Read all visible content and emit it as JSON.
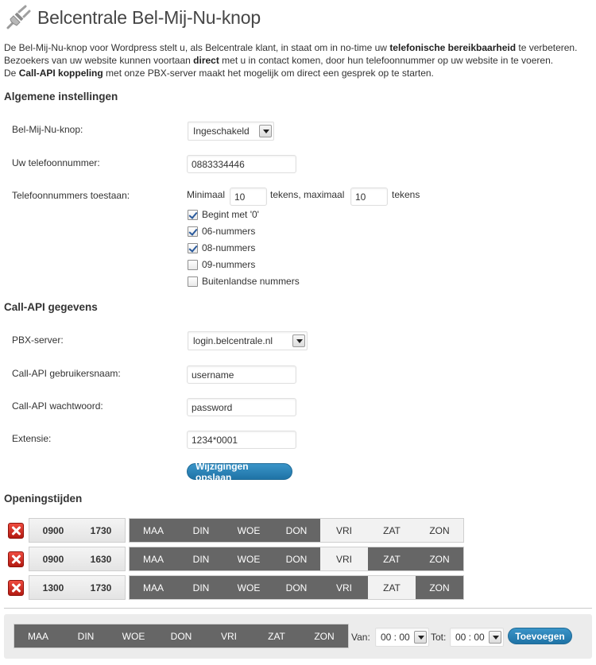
{
  "header": {
    "title": "Belcentrale Bel-Mij-Nu-knop"
  },
  "intro": {
    "line1_pre": "De Bel-Mij-Nu-knop voor Wordpress stelt u, als Belcentrale klant, in staat om in no-time uw ",
    "line1_bold": "telefonische bereikbaarheid",
    "line1_post": " te verbeteren.",
    "line2_pre": "Bezoekers van uw website kunnen voortaan ",
    "line2_bold": "direct",
    "line2_post": " met u in contact komen, door hun telefoonnummer op uw website in te voeren.",
    "line3_pre": "De ",
    "line3_bold": "Call-API koppeling",
    "line3_post": " met onze PBX-server maakt het mogelijk om direct een gesprek op te starten."
  },
  "general": {
    "heading": "Algemene instellingen",
    "button_label": "Bel-Mij-Nu-knop:",
    "button_value": "Ingeschakeld",
    "phone_label": "Uw telefoonnummer:",
    "phone_value": "0883334446",
    "allowed_label": "Telefoonnummers toestaan:",
    "min_label": "Minimaal",
    "min_value": "10",
    "mid_label": "tekens, maximaal",
    "max_value": "10",
    "end_label": "tekens",
    "checkboxes": [
      {
        "label": "Begint met '0'",
        "checked": true
      },
      {
        "label": "06-nummers",
        "checked": true
      },
      {
        "label": "08-nummers",
        "checked": true
      },
      {
        "label": "09-nummers",
        "checked": false
      },
      {
        "label": "Buitenlandse nummers",
        "checked": false
      }
    ]
  },
  "callapi": {
    "heading": "Call-API gegevens",
    "server_label": "PBX-server:",
    "server_value": "login.belcentrale.nl",
    "user_label": "Call-API gebruikersnaam:",
    "user_value": "username",
    "pass_label": "Call-API wachtwoord:",
    "pass_value": "password",
    "ext_label": "Extensie:",
    "ext_value": "1234*0001",
    "save_label": "Wijzigingen opslaan"
  },
  "hours": {
    "heading": "Openingstijden",
    "days": [
      "MAA",
      "DIN",
      "WOE",
      "DON",
      "VRI",
      "ZAT",
      "ZON"
    ],
    "rows": [
      {
        "from": "0900",
        "to": "1730",
        "off": [
          4,
          5,
          6
        ]
      },
      {
        "from": "0900",
        "to": "1630",
        "off": [
          4
        ]
      },
      {
        "from": "1300",
        "to": "1730",
        "off": [
          5
        ]
      }
    ]
  },
  "add": {
    "from_label": "Van:",
    "from_value": "00 : 00",
    "to_label": "Tot:",
    "to_value": "00 : 00",
    "add_label": "Toevoegen"
  },
  "colors": {
    "day_on": "#666666",
    "day_off": "#f2f2f2",
    "accent": "#2a84b9",
    "delete": "#d32a1f"
  }
}
